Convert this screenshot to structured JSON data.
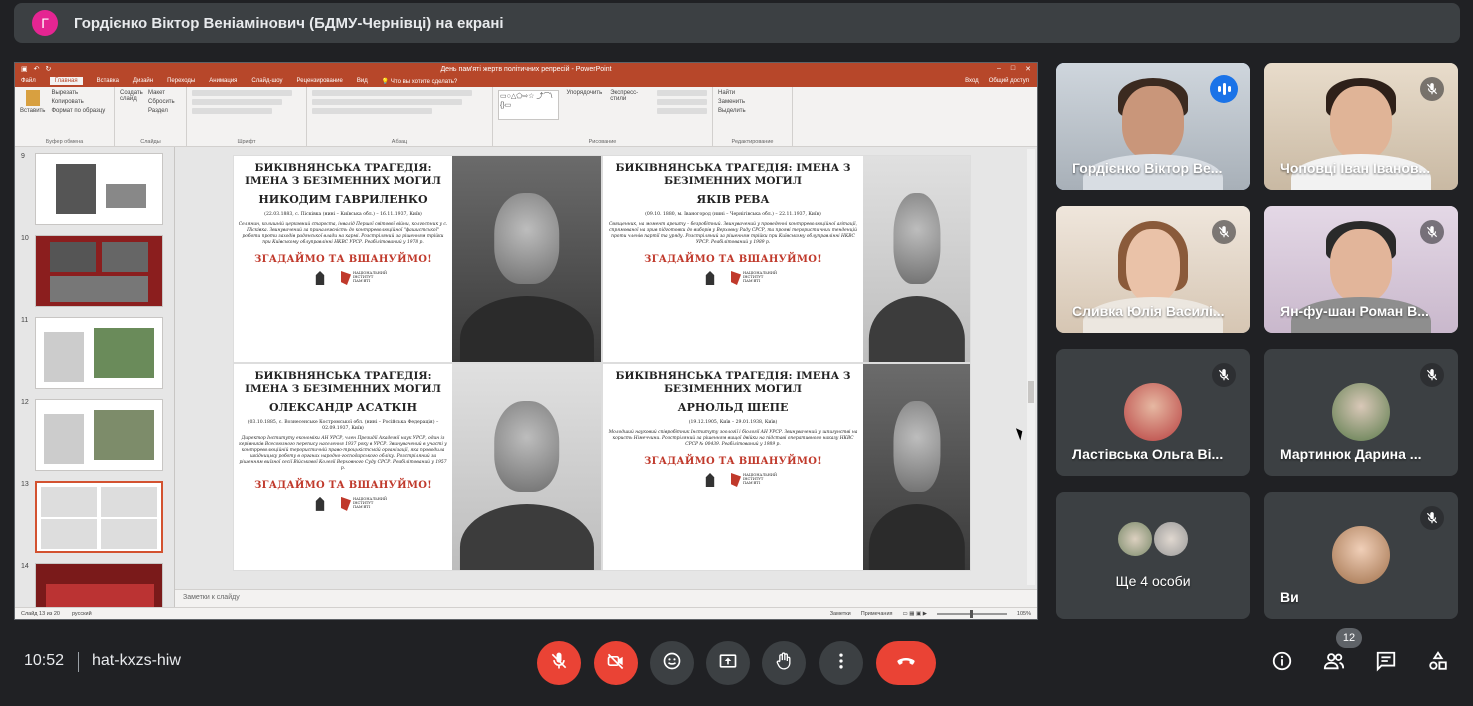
{
  "presenter_banner": {
    "avatar_letter": "Г",
    "avatar_color": "#e52592",
    "text": "Гордієнко Віктор Веніамінович (БДМУ-Чернівці) на екрані"
  },
  "powerpoint": {
    "doc_title": "День пам'яті жертв політичних репресій - PowerPoint",
    "tabs": [
      "Файл",
      "Главная",
      "Вставка",
      "Дизайн",
      "Переходы",
      "Анимация",
      "Слайд-шоу",
      "Рецензирование",
      "Вид"
    ],
    "tell_me": "Что вы хотите сделать?",
    "sign_in": "Вход",
    "share": "Общий доступ",
    "ribbon_groups": [
      "Буфер обмена",
      "Слайды",
      "Шрифт",
      "Абзац",
      "Рисование",
      "Редактирование"
    ],
    "ribbon_buttons": {
      "paste": "Вставить",
      "cut": "Вырезать",
      "copy": "Копировать",
      "format_painter": "Формат по образцу",
      "new_slide": "Создать слайд",
      "layout": "Макет",
      "reset": "Сбросить",
      "section": "Раздел",
      "arrange": "Упорядочить",
      "quick_styles": "Экспресс-стили",
      "find": "Найти",
      "replace": "Заменить",
      "select": "Выделить"
    },
    "thumbnail_numbers": [
      "9",
      "10",
      "11",
      "12",
      "13",
      "14"
    ],
    "notes_placeholder": "Заметки к слайду",
    "status": {
      "slide_of": "Слайд 13 из 20",
      "language": "русский",
      "notes": "Заметки",
      "comments": "Примечания",
      "zoom": "105%"
    }
  },
  "slide_cards": [
    {
      "title": "БИКІВНЯНСЬКА ТРАГЕДІЯ: ІМЕНА З БЕЗІМЕННИХ МОГИЛ",
      "name": "НИКОДИМ ГАВРИЛЕНКО",
      "dates": "(22.03.1883, с. Пісківка (нині – Київська обл.) – 16.11.1937, Київ)",
      "bio": "Селянин, колишній церковний староста, інвалід Першої світової війни, колгоспник у с. Пісківка. Звинувачений за приналежність до контрреволюційної \"фашистської\" роботи проти заходів радянської влади на кармі. Розстріляний за рішенням трійки при Київському облуправлінні НКВС УРСР. Реабілітований у 1978 р.",
      "slogan": "ЗГАДАЙМО ТА ВШАНУЙМО!"
    },
    {
      "title": "БИКІВНЯНСЬКА ТРАГЕДІЯ: ІМЕНА З БЕЗІМЕННИХ МОГИЛ",
      "name": "ЯКІВ РЕВА",
      "dates": "(09.10. 1880, м. Іваногород (нині – Чернігівська обл.) – 22.11.1937, Київ)",
      "bio": "Священник, на момент арешту – безробітний. Звинувачений у проведенні контрреволюційної агітації, спрямованої на зрив підготовки до виборів у Верховну Раду СРСР, та прояві терористичних тенденцій проти членів партії та уряду. Розстріляний за рішенням трійки при Київському облуправлінні НКВС УРСР. Реабілітований у 1989 р.",
      "slogan": "ЗГАДАЙМО ТА ВШАНУЙМО!"
    },
    {
      "title": "БИКІВНЯНСЬКА ТРАГЕДІЯ: ІМЕНА З БЕЗІМЕННИХ МОГИЛ",
      "name": "ОЛЕКСАНДР АСАТКІН",
      "dates": "(03.10.1885, с. Вознесенське Костромської обл. (нині – Російська Федерація) – 02.09.1937, Київ)",
      "bio": "Директор Інституту економіки АН УРСР, член Президії Академії наук УРСР, один із керівників Всесоюзного перепису населення 1937 року в УРСР. Звинувачений в участі у контрреволюційній терористичній право-троцькістській організації, яка проводила шкідницьку роботу в органах народно-господарського обліку. Розстріляний за рішенням виїзної сесії Військової Колегії Верховного Суду СРСР. Реабілітований у 1957 р.",
      "slogan": "ЗГАДАЙМО ТА ВШАНУЙМО!"
    },
    {
      "title": "БИКІВНЯНСЬКА ТРАГЕДІЯ: ІМЕНА З БЕЗІМЕННИХ МОГИЛ",
      "name": "АРНОЛЬД ШЕПЕ",
      "dates": "(19.12.1905, Київ – 29.01.1938, Київ)",
      "bio": "Молодший науковий співробітник Інституту зоології і біології АН УРСР. Звинувачений у шпигунстві на користь Німеччини. Розстріляний за рішенням вищої двійки на підставі оперативного наказу НКВС СРСР № 00439. Реабілітований у 1989 р.",
      "slogan": "ЗГАДАЙМО ТА ВШАНУЙМО!"
    }
  ],
  "logo_text": "НАЦІОНАЛЬНИЙ ІНСТИТУТ ПАМ'ЯТІ",
  "participants": [
    {
      "name": "Гордієнко Віктор Ве...",
      "speaking": true,
      "muted": false
    },
    {
      "name": "Чоповці Іван Іванов...",
      "speaking": false,
      "muted": true
    },
    {
      "name": "Сливка Юлія Василі...",
      "speaking": false,
      "muted": true
    },
    {
      "name": "Ян-фу-шан Роман В...",
      "speaking": false,
      "muted": true
    },
    {
      "name": "Ластівська Ольга Ві...",
      "speaking": false,
      "muted": true
    },
    {
      "name": "Мартинюк Дарина ...",
      "speaking": false,
      "muted": true
    },
    {
      "name": "Ще 4 особи",
      "speaking": false,
      "muted": false
    },
    {
      "name": "Ви",
      "speaking": false,
      "muted": true
    }
  ],
  "bottom_bar": {
    "time": "10:52",
    "meeting_code": "hat-kxzs-hiw",
    "participant_count": "12",
    "accent_red": "#ea4335",
    "icons": [
      "mic-off-icon",
      "camera-off-icon",
      "emoji-icon",
      "present-icon",
      "raise-hand-icon",
      "more-options-icon",
      "end-call-icon",
      "info-icon",
      "people-icon",
      "chat-icon",
      "activities-icon"
    ]
  }
}
